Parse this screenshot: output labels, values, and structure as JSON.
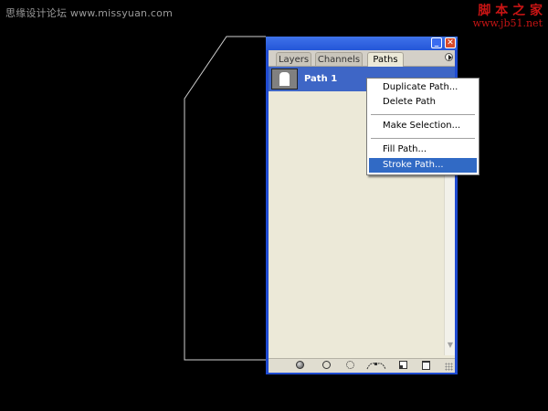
{
  "watermark": {
    "left_text": "思缘设计论坛 www.missyuan.com",
    "right_line1": "脚 本 之 家",
    "right_line2": "www.jb51.net"
  },
  "palette": {
    "tabs": [
      {
        "label": "Layers"
      },
      {
        "label": "Channels"
      },
      {
        "label": "Paths"
      }
    ],
    "active_tab": "Paths",
    "paths": [
      {
        "name": "Path 1",
        "selected": true
      }
    ],
    "title_buttons": {
      "minimize": "_",
      "close": "✕"
    },
    "footer_icons": [
      "fill-path-icon",
      "stroke-path-icon",
      "load-as-selection-icon",
      "make-work-path-icon",
      "new-path-icon",
      "delete-path-icon"
    ]
  },
  "context_menu": {
    "items": [
      {
        "label": "Duplicate Path..."
      },
      {
        "label": "Delete Path"
      },
      {
        "label": "Make Selection..."
      },
      {
        "label": "Fill Path..."
      },
      {
        "label": "Stroke Path...",
        "highlighted": true
      }
    ]
  },
  "colors": {
    "canvas": "#000000",
    "window_frame": "#1f4bd1",
    "selection": "#316ac5",
    "path_row": "#3e66c6",
    "watermark_red": "#c81414"
  }
}
